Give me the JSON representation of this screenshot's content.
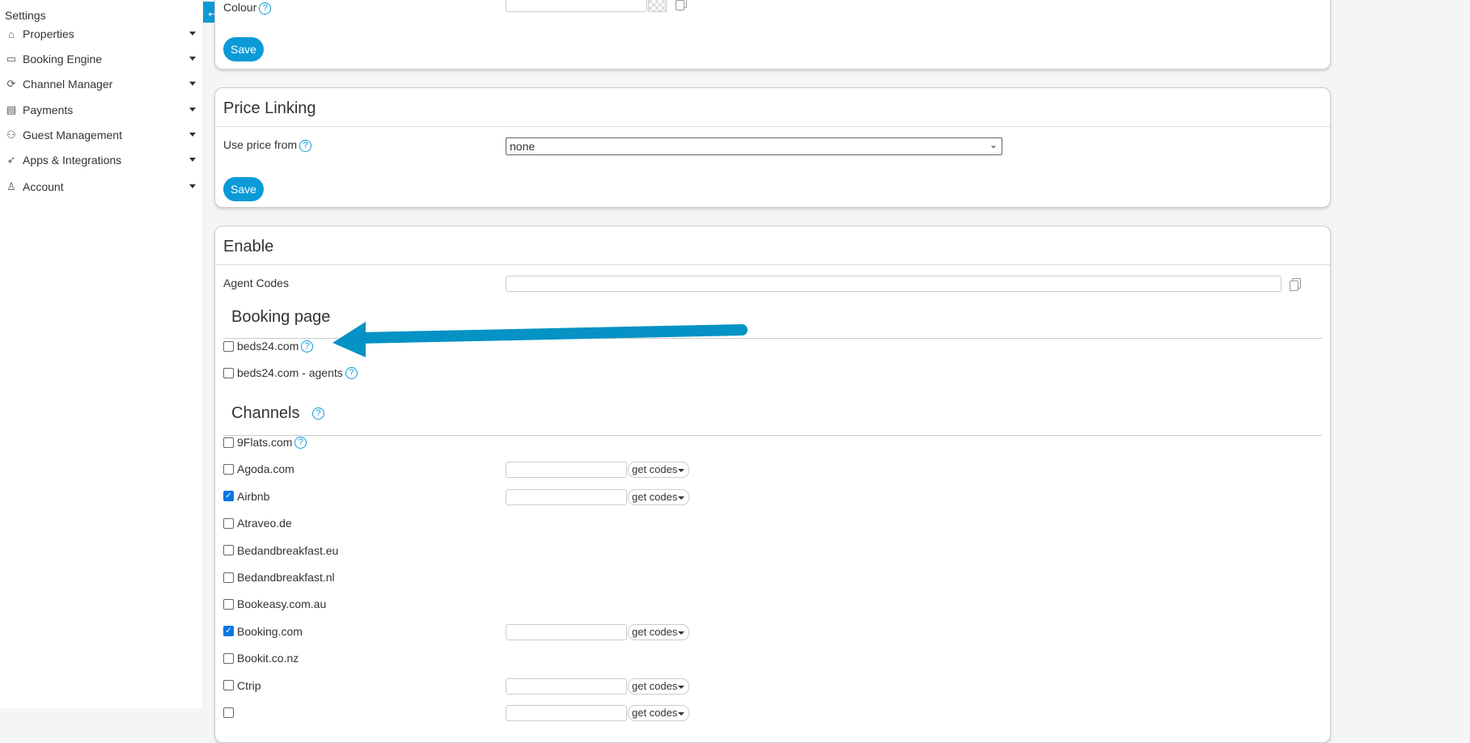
{
  "sidebar": {
    "title": "Settings",
    "items": [
      {
        "label": "Properties",
        "icon": "home-icon"
      },
      {
        "label": "Booking Engine",
        "icon": "monitor-icon"
      },
      {
        "label": "Channel Manager",
        "icon": "sync-icon"
      },
      {
        "label": "Payments",
        "icon": "credit-card-icon"
      },
      {
        "label": "Guest Management",
        "icon": "users-icon"
      },
      {
        "label": "Apps & Integrations",
        "icon": "rocket-icon"
      },
      {
        "label": "Account",
        "icon": "user-icon"
      }
    ]
  },
  "colour_card": {
    "label": "Colour",
    "save": "Save"
  },
  "price_linking": {
    "title": "Price Linking",
    "label": "Use price from",
    "value": "none",
    "save": "Save"
  },
  "enable": {
    "title": "Enable",
    "agent_codes_label": "Agent Codes",
    "booking_page_title": "Booking page",
    "booking_page": [
      {
        "label": "beds24.com",
        "checked": false
      },
      {
        "label": "beds24.com - agents",
        "checked": false
      }
    ],
    "channels_title": "Channels",
    "get_codes": "get codes",
    "channels": [
      {
        "label": "9Flats.com",
        "checked": false,
        "help": true,
        "codes": false
      },
      {
        "label": "Agoda.com",
        "checked": false,
        "codes": true
      },
      {
        "label": "Airbnb",
        "checked": true,
        "codes": true
      },
      {
        "label": "Atraveo.de",
        "checked": false,
        "codes": false
      },
      {
        "label": "Bedandbreakfast.eu",
        "checked": false,
        "codes": false
      },
      {
        "label": "Bedandbreakfast.nl",
        "checked": false,
        "codes": false
      },
      {
        "label": "Bookeasy.com.au",
        "checked": false,
        "codes": false
      },
      {
        "label": "Booking.com",
        "checked": true,
        "codes": true
      },
      {
        "label": "Bookit.co.nz",
        "checked": false,
        "codes": false
      },
      {
        "label": "Ctrip",
        "checked": false,
        "codes": true
      },
      {
        "label": "",
        "checked": false,
        "codes": true
      }
    ]
  },
  "colors": {
    "accent": "#0b9ad8",
    "arrow": "#0592c4"
  }
}
